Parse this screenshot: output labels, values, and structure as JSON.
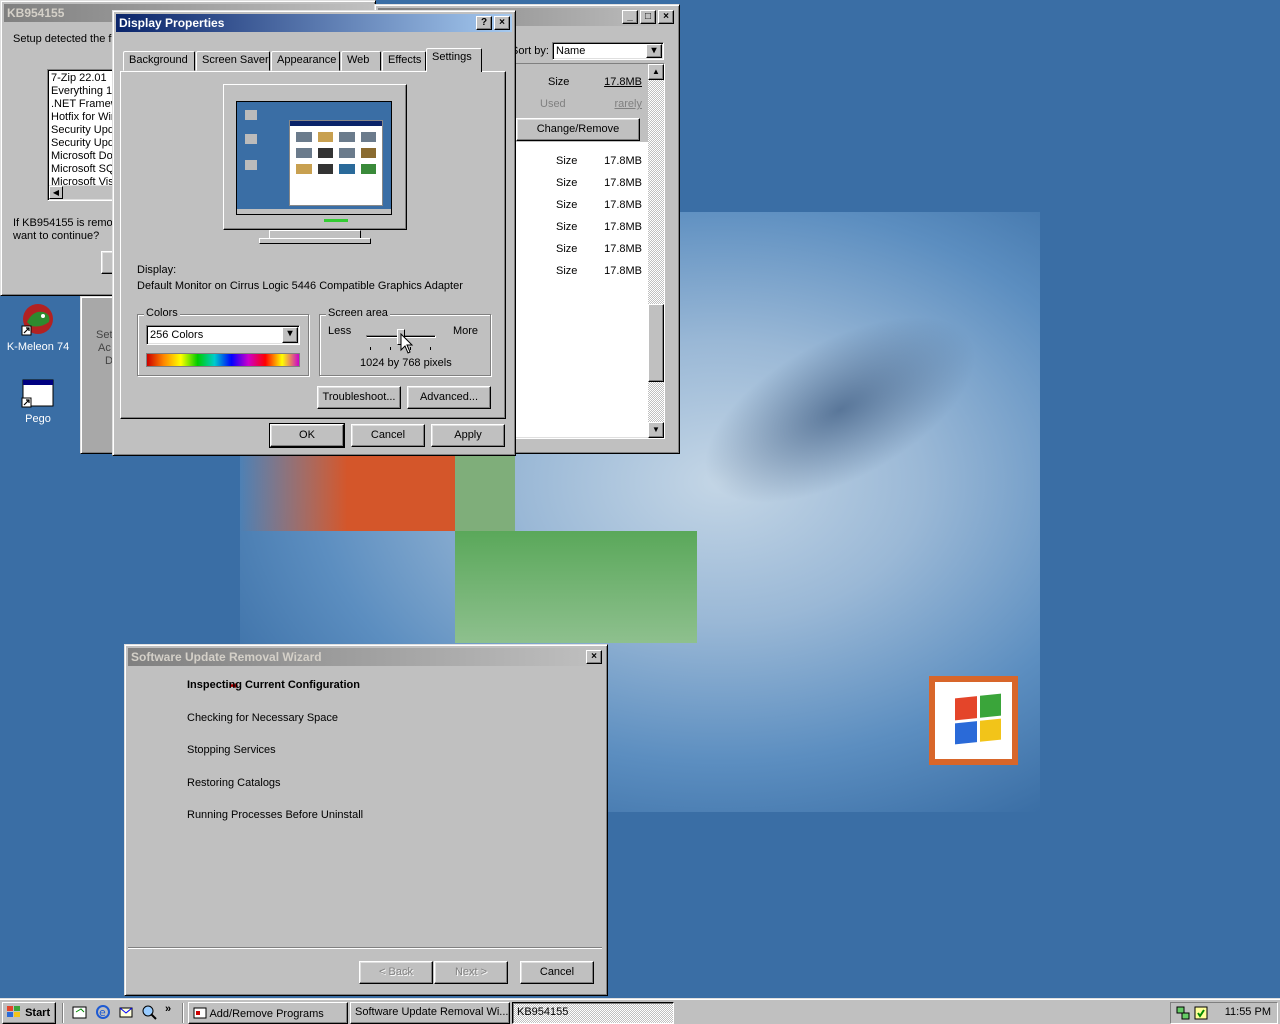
{
  "desktop": {
    "icons": [
      {
        "label": "K-Meleon 74",
        "icon": "k-meleon-icon"
      },
      {
        "label": "Pego",
        "icon": "application-window-icon"
      }
    ]
  },
  "kb_window": {
    "title": "KB954155",
    "message_top": "Setup detected the f",
    "list_items": [
      "7-Zip 22.01",
      "Everything 1.",
      ".NET Framew",
      "Hotfix for Wir",
      "Security Upd",
      "Security Upd",
      "Microsoft Do",
      "Microsoft SQ",
      "Microsoft Vis"
    ],
    "question_line1": "If KB954155 is remov",
    "question_line2": "want to continue?",
    "side_text": [
      "Set",
      "Ac",
      "D"
    ]
  },
  "addremove_window": {
    "sort_label": "Sort by:",
    "sort_value": "Name",
    "selected_item": {
      "size_label": "Size",
      "size_value": "17.8MB",
      "used_label": "Used",
      "used_value": "rarely",
      "change_remove_label": "Change/Remove"
    },
    "rows": [
      {
        "label": "Size",
        "value": "17.8MB"
      },
      {
        "label": "Size",
        "value": "17.8MB"
      },
      {
        "label": "Size",
        "value": "17.8MB"
      },
      {
        "label": "Size",
        "value": "17.8MB"
      },
      {
        "label": "Size",
        "value": "17.8MB"
      },
      {
        "label": "Size",
        "value": "17.8MB"
      }
    ]
  },
  "display_properties": {
    "title": "Display Properties",
    "tabs": [
      "Background",
      "Screen Saver",
      "Appearance",
      "Web",
      "Effects",
      "Settings"
    ],
    "selected_tab": "Settings",
    "display_label": "Display:",
    "display_value": "Default Monitor on Cirrus Logic 5446 Compatible Graphics Adapter",
    "colors_label": "Colors",
    "colors_value": "256 Colors",
    "screen_area_label": "Screen area",
    "less_label": "Less",
    "more_label": "More",
    "resolution": "1024 by 768 pixels",
    "resolution_slider_level": 0.5,
    "troubleshoot_label": "Troubleshoot...",
    "advanced_label": "Advanced...",
    "ok_label": "OK",
    "cancel_label": "Cancel",
    "apply_label": "Apply"
  },
  "wizard": {
    "title": "Software Update Removal Wizard",
    "steps": [
      "Inspecting Current Configuration",
      "Checking for Necessary Space",
      "Stopping Services",
      "Restoring Catalogs",
      "Running Processes Before Uninstall"
    ],
    "current_step": 0,
    "back_label": "< Back",
    "next_label": "Next >",
    "cancel_label": "Cancel"
  },
  "taskbar": {
    "start_label": "Start",
    "tasks": [
      "Add/Remove Programs",
      "Software Update Removal Wi...",
      "KB954155"
    ],
    "quick_launch_chevron": "»",
    "clock": "11:55 PM"
  },
  "colors": {
    "desktop": "#3a6ea5",
    "title_active": "#0a246a",
    "title_inactive": "#808080",
    "face": "#c0c0c0",
    "link": "#0000ff"
  }
}
